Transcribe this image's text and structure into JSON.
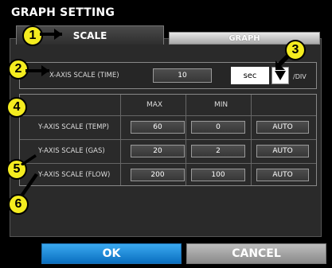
{
  "title": "GRAPH SETTING",
  "tabs": [
    {
      "label": "SCALE"
    },
    {
      "label": "GRAPH"
    }
  ],
  "x_axis": {
    "label": "X-AXIS SCALE (TIME)",
    "value": "10",
    "unit": "sec",
    "per_div": "/DIV"
  },
  "table": {
    "headers": {
      "max": "MAX",
      "min": "MIN"
    },
    "rows": [
      {
        "label": "Y-AXIS SCALE (TEMP)",
        "max": "60",
        "min": "0",
        "auto": "AUTO"
      },
      {
        "label": "Y-AXIS SCALE (GAS)",
        "max": "20",
        "min": "2",
        "auto": "AUTO"
      },
      {
        "label": "Y-AXIS SCALE (FLOW)",
        "max": "200",
        "min": "100",
        "auto": "AUTO"
      }
    ]
  },
  "markers": [
    "1",
    "2",
    "3",
    "4",
    "5",
    "6"
  ],
  "buttons": {
    "ok": "OK",
    "cancel": "CANCEL"
  },
  "colors": {
    "marker": "#f4ec1f",
    "ok": "#1e8ad8",
    "cancel": "#a0a0a0"
  }
}
